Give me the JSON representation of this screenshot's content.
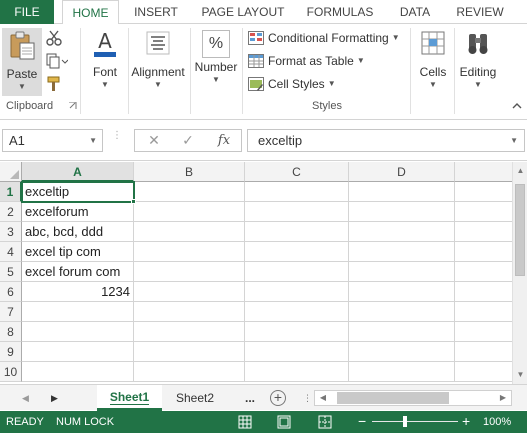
{
  "ribbon_tabs": {
    "file": "FILE",
    "home": "HOME",
    "insert": "INSERT",
    "page_layout": "PAGE LAYOUT",
    "formulas": "FORMULAS",
    "data": "DATA",
    "review": "REVIEW"
  },
  "clipboard": {
    "paste": "Paste",
    "group_label": "Clipboard"
  },
  "font_group": {
    "label": "Font"
  },
  "alignment_group": {
    "label": "Alignment"
  },
  "number_group": {
    "label": "Number",
    "icon_text": "%"
  },
  "styles": {
    "conditional_formatting": "Conditional Formatting",
    "format_as_table": "Format as Table",
    "cell_styles": "Cell Styles",
    "group_label": "Styles"
  },
  "cells_group": {
    "label": "Cells"
  },
  "editing_group": {
    "label": "Editing"
  },
  "formula_bar": {
    "name_box": "A1",
    "cancel": "✕",
    "enter": "✓",
    "fx": "fx",
    "value": "exceltip"
  },
  "columns": [
    "A",
    "B",
    "C",
    "D"
  ],
  "rows": [
    "1",
    "2",
    "3",
    "4",
    "5",
    "6",
    "7",
    "8",
    "9",
    "10"
  ],
  "cells": {
    "A1": "exceltip",
    "A2": "excelforum",
    "A3": "abc, bcd, ddd",
    "A4": "excel tip com",
    "A5": "excel forum com",
    "A6": "1234"
  },
  "sheets": {
    "sheet1": "Sheet1",
    "sheet2": "Sheet2",
    "more": "...",
    "add": "+"
  },
  "status": {
    "ready": "READY",
    "num_lock": "NUM LOCK",
    "zoom": "100%",
    "zoom_out": "−",
    "zoom_in": "+",
    "zoom_level": 1.0
  },
  "colors": {
    "accent": "#217346",
    "gridline": "#d4d4d4",
    "header_bg": "#f3f3f3"
  },
  "icons": {
    "paste": "clipboard-paste-icon",
    "cut": "scissors-icon",
    "copy": "copy-icon",
    "format_painter": "format-painter-icon",
    "font": "font-a-icon",
    "alignment": "align-lines-icon",
    "number": "percent-icon",
    "conditional_formatting": "conditional-formatting-icon",
    "format_as_table": "table-icon",
    "cell_styles": "cell-styles-icon",
    "cells": "cells-icon",
    "editing": "binoculars-icon"
  }
}
